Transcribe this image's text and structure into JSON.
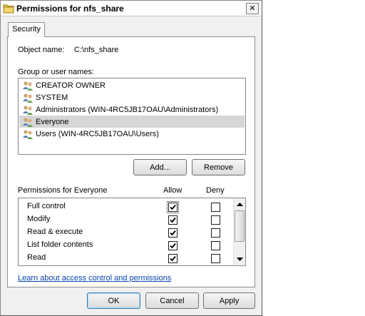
{
  "window": {
    "title": "Permissions for nfs_share",
    "close_symbol": "✕"
  },
  "tabs": [
    {
      "label": "Security"
    }
  ],
  "object": {
    "label": "Object name:",
    "value": "C:\\nfs_share"
  },
  "group": {
    "label": "Group or user names:",
    "items": [
      {
        "label": "CREATOR OWNER",
        "selected": false
      },
      {
        "label": "SYSTEM",
        "selected": false
      },
      {
        "label": "Administrators (WIN-4RC5JB17OAU\\Administrators)",
        "selected": false
      },
      {
        "label": "Everyone",
        "selected": true
      },
      {
        "label": "Users (WIN-4RC5JB17OAU\\Users)",
        "selected": false
      }
    ]
  },
  "buttons": {
    "add": "Add...",
    "remove": "Remove",
    "ok": "OK",
    "cancel": "Cancel",
    "apply": "Apply"
  },
  "permissions": {
    "header": "Permissions for Everyone",
    "allow_label": "Allow",
    "deny_label": "Deny",
    "rows": [
      {
        "label": "Full control",
        "allow": true,
        "deny": false
      },
      {
        "label": "Modify",
        "allow": true,
        "deny": false
      },
      {
        "label": "Read & execute",
        "allow": true,
        "deny": false
      },
      {
        "label": "List folder contents",
        "allow": true,
        "deny": false
      },
      {
        "label": "Read",
        "allow": true,
        "deny": false
      }
    ]
  },
  "link": {
    "text": "Learn about access control and permissions"
  },
  "icons": {
    "title": "folder-icon",
    "users": "user-group-icon",
    "checkbox": "checkbox-icon",
    "scroll_up": "scroll-up-arrow-icon",
    "scroll_down": "scroll-down-arrow-icon"
  },
  "colors": {
    "dialog_bg": "#f0f0f0",
    "selection": "#d6d6d6",
    "link": "#0645ad"
  }
}
